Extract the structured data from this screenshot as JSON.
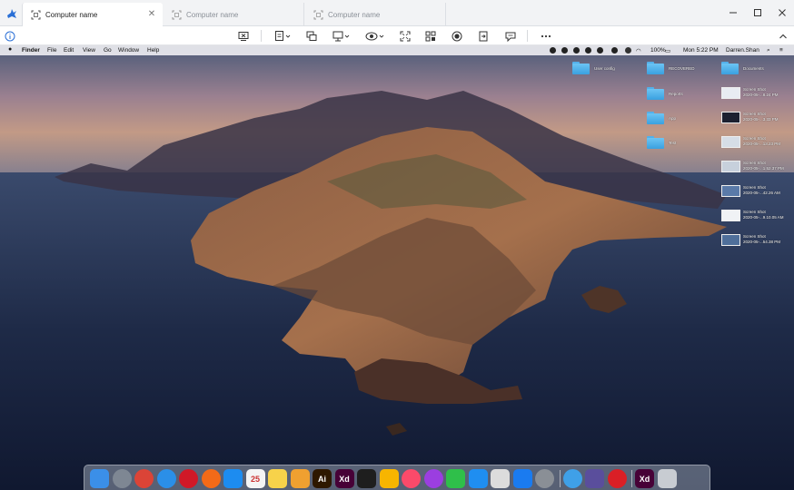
{
  "tabs": [
    {
      "label": "Computer name",
      "active": true
    },
    {
      "label": "Computer name",
      "active": false
    },
    {
      "label": "Computer name",
      "active": false
    }
  ],
  "toolbar": {
    "icons": [
      "end-session-icon",
      "file-transfer-icon",
      "remote-control-icon",
      "screen-select-icon",
      "view-mode-icon",
      "fullscreen-icon",
      "split-screen-icon",
      "record-icon",
      "export-icon",
      "chat-icon",
      "more-icon"
    ]
  },
  "mac_menubar": {
    "app": "Finder",
    "menus": [
      "File",
      "Edit",
      "View",
      "Go",
      "Window",
      "Help"
    ],
    "battery": "100%",
    "clock": "Mon 5:22 PM",
    "user": "Darren.Shan"
  },
  "desktop": {
    "folders": [
      {
        "label": "User config"
      },
      {
        "label": "RECOVERED"
      },
      {
        "label": "Documents"
      },
      {
        "label": "Reports"
      },
      {
        "label": "App"
      },
      {
        "label": "Test"
      }
    ],
    "screenshots": [
      {
        "label1": "Screen Shot",
        "label2": "2020-05-...8.24 PM"
      },
      {
        "label1": "Screen Shot",
        "label2": "2020-05-...3.33 PM"
      },
      {
        "label1": "Screen Shot",
        "label2": "2020-05-...13.23 PM"
      },
      {
        "label1": "Screen Shot",
        "label2": "2020-05-...1.52.37 PM"
      },
      {
        "label1": "Screen Shot",
        "label2": "2020-05-...42.26 AM"
      },
      {
        "label1": "Screen Shot",
        "label2": "2020-05-...9.10.05 AM"
      },
      {
        "label1": "Screen Shot",
        "label2": "2020-05-...54.38 PM"
      }
    ]
  },
  "dock": {
    "apps": [
      {
        "name": "finder-icon",
        "color": "#3b8fe8",
        "text": ""
      },
      {
        "name": "launchpad-icon",
        "color": "#7e8793",
        "text": ""
      },
      {
        "name": "chrome-icon",
        "color": "#db4437",
        "text": ""
      },
      {
        "name": "safari-icon",
        "color": "#2b8fe8",
        "text": ""
      },
      {
        "name": "opera-icon",
        "color": "#d01827",
        "text": ""
      },
      {
        "name": "firefox-icon",
        "color": "#f36a18",
        "text": ""
      },
      {
        "name": "app-store-icon",
        "color": "#1d8cf0",
        "text": ""
      },
      {
        "name": "calendar-icon",
        "color": "#f4f4f4",
        "text": "25"
      },
      {
        "name": "notes-icon",
        "color": "#f7d24a",
        "text": ""
      },
      {
        "name": "squirrel-icon",
        "color": "#f0a030",
        "text": ""
      },
      {
        "name": "illustrator-icon",
        "color": "#2e1800",
        "text": "Ai"
      },
      {
        "name": "xd-icon",
        "color": "#470137",
        "text": "Xd"
      },
      {
        "name": "figma-icon",
        "color": "#1e1e1e",
        "text": ""
      },
      {
        "name": "sketch-icon",
        "color": "#f7b500",
        "text": ""
      },
      {
        "name": "music-icon",
        "color": "#fb4a6a",
        "text": ""
      },
      {
        "name": "podcasts-icon",
        "color": "#9b3ee0",
        "text": ""
      },
      {
        "name": "numbers-icon",
        "color": "#2fbf4a",
        "text": ""
      },
      {
        "name": "keynote-icon",
        "color": "#1f8ef1",
        "text": ""
      },
      {
        "name": "preview-icon",
        "color": "#dcdcdc",
        "text": ""
      },
      {
        "name": "xcode-icon",
        "color": "#1a7bf0",
        "text": ""
      },
      {
        "name": "system-preferences-icon",
        "color": "#8a8f96",
        "text": ""
      },
      {
        "name": "remote-app-icon",
        "color": "#3fa0e8",
        "text": ""
      },
      {
        "name": "teamviewer-icon",
        "color": "#5a4e9c",
        "text": ""
      },
      {
        "name": "creative-cloud-icon",
        "color": "#da1f26",
        "text": ""
      },
      {
        "name": "xd-doc-icon",
        "color": "#470137",
        "text": "Xd"
      },
      {
        "name": "trash-icon",
        "color": "#c8ccd2",
        "text": ""
      }
    ]
  }
}
